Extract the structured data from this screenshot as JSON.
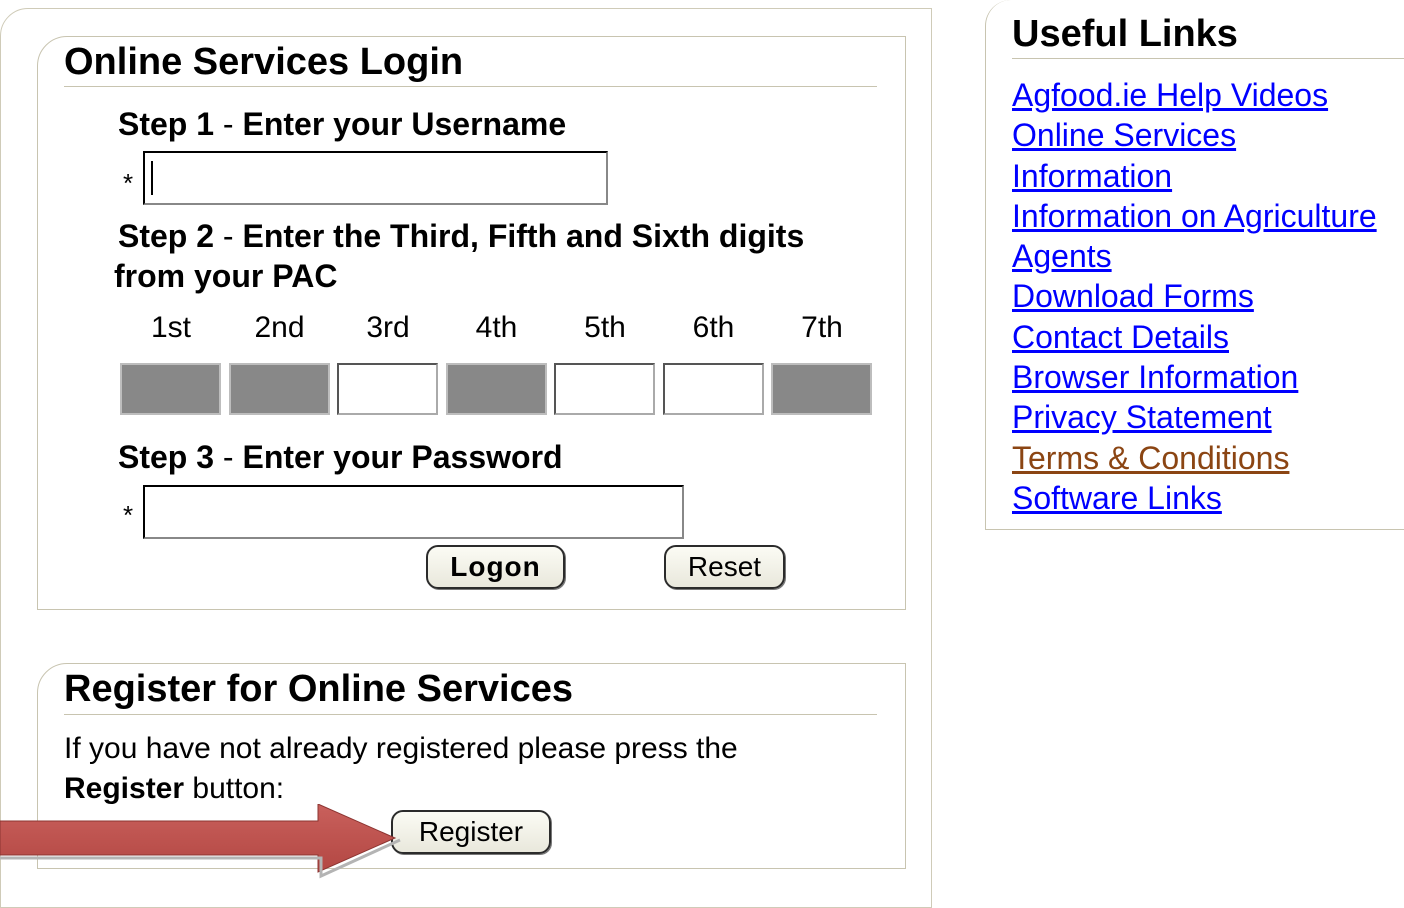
{
  "login": {
    "title": "Online Services Login",
    "step1": {
      "label": "Step 1",
      "sep": " - ",
      "text": "Enter your Username"
    },
    "step2": {
      "label": "Step 2",
      "sep": " - ",
      "text": "Enter the Third, Fifth and Sixth digits",
      "text2": "from your PAC"
    },
    "step3": {
      "label": "Step 3",
      "sep": " - ",
      "text": "Enter your Password"
    },
    "required_marker": "*",
    "username_value": "",
    "password_value": "",
    "pac_positions": [
      "1st",
      "2nd",
      "3rd",
      "4th",
      "5th",
      "6th",
      "7th"
    ],
    "pac_enabled": [
      false,
      false,
      true,
      false,
      true,
      true,
      false
    ],
    "logon_label": "Logon",
    "reset_label": "Reset"
  },
  "register": {
    "title": "Register for Online Services",
    "text": "If you have not already registered please press the",
    "text_bold": "Register",
    "text_end": " button:",
    "button_label": "Register"
  },
  "useful_links": {
    "title": "Useful Links",
    "items": [
      {
        "label": "Agfood.ie Help Videos",
        "visited": false
      },
      {
        "label": "Online Services",
        "visited": false
      },
      {
        "label": "Information",
        "visited": false
      },
      {
        "label": "Information on Agriculture",
        "visited": false
      },
      {
        "label": "Agents",
        "visited": false
      },
      {
        "label": "Download Forms",
        "visited": false
      },
      {
        "label": "Contact Details",
        "visited": false
      },
      {
        "label": "Browser Information",
        "visited": false
      },
      {
        "label": "Privacy Statement",
        "visited": false
      },
      {
        "label": "Terms & Conditions",
        "visited": true
      },
      {
        "label": "Software Links",
        "visited": false
      }
    ]
  },
  "colors": {
    "link": "#0000ff",
    "visited_link": "#8b4513",
    "arrow": "#c0504d",
    "disabled_cell": "#888888"
  }
}
